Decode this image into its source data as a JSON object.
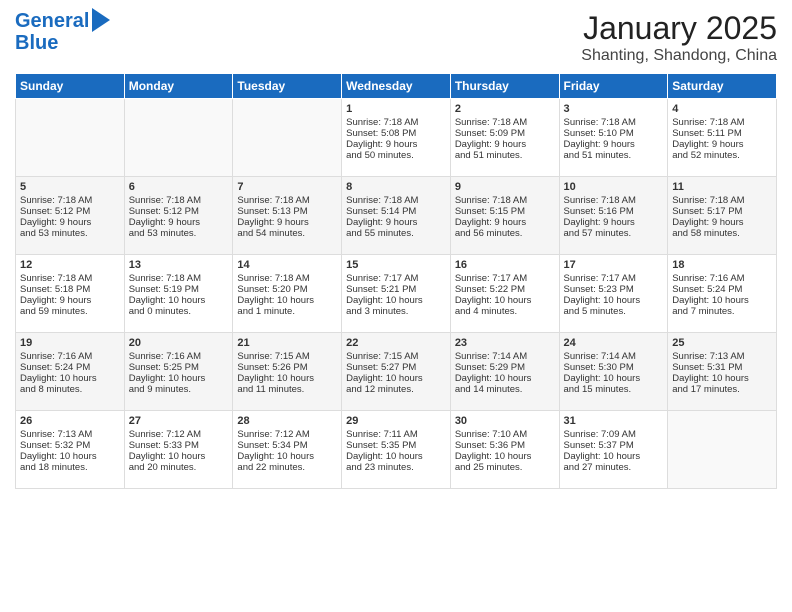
{
  "logo": {
    "line1": "General",
    "line2": "Blue"
  },
  "title": "January 2025",
  "subtitle": "Shanting, Shandong, China",
  "days_header": [
    "Sunday",
    "Monday",
    "Tuesday",
    "Wednesday",
    "Thursday",
    "Friday",
    "Saturday"
  ],
  "weeks": [
    [
      {
        "day": "",
        "info": ""
      },
      {
        "day": "",
        "info": ""
      },
      {
        "day": "",
        "info": ""
      },
      {
        "day": "1",
        "info": "Sunrise: 7:18 AM\nSunset: 5:08 PM\nDaylight: 9 hours\nand 50 minutes."
      },
      {
        "day": "2",
        "info": "Sunrise: 7:18 AM\nSunset: 5:09 PM\nDaylight: 9 hours\nand 51 minutes."
      },
      {
        "day": "3",
        "info": "Sunrise: 7:18 AM\nSunset: 5:10 PM\nDaylight: 9 hours\nand 51 minutes."
      },
      {
        "day": "4",
        "info": "Sunrise: 7:18 AM\nSunset: 5:11 PM\nDaylight: 9 hours\nand 52 minutes."
      }
    ],
    [
      {
        "day": "5",
        "info": "Sunrise: 7:18 AM\nSunset: 5:12 PM\nDaylight: 9 hours\nand 53 minutes."
      },
      {
        "day": "6",
        "info": "Sunrise: 7:18 AM\nSunset: 5:12 PM\nDaylight: 9 hours\nand 53 minutes."
      },
      {
        "day": "7",
        "info": "Sunrise: 7:18 AM\nSunset: 5:13 PM\nDaylight: 9 hours\nand 54 minutes."
      },
      {
        "day": "8",
        "info": "Sunrise: 7:18 AM\nSunset: 5:14 PM\nDaylight: 9 hours\nand 55 minutes."
      },
      {
        "day": "9",
        "info": "Sunrise: 7:18 AM\nSunset: 5:15 PM\nDaylight: 9 hours\nand 56 minutes."
      },
      {
        "day": "10",
        "info": "Sunrise: 7:18 AM\nSunset: 5:16 PM\nDaylight: 9 hours\nand 57 minutes."
      },
      {
        "day": "11",
        "info": "Sunrise: 7:18 AM\nSunset: 5:17 PM\nDaylight: 9 hours\nand 58 minutes."
      }
    ],
    [
      {
        "day": "12",
        "info": "Sunrise: 7:18 AM\nSunset: 5:18 PM\nDaylight: 9 hours\nand 59 minutes."
      },
      {
        "day": "13",
        "info": "Sunrise: 7:18 AM\nSunset: 5:19 PM\nDaylight: 10 hours\nand 0 minutes."
      },
      {
        "day": "14",
        "info": "Sunrise: 7:18 AM\nSunset: 5:20 PM\nDaylight: 10 hours\nand 1 minute."
      },
      {
        "day": "15",
        "info": "Sunrise: 7:17 AM\nSunset: 5:21 PM\nDaylight: 10 hours\nand 3 minutes."
      },
      {
        "day": "16",
        "info": "Sunrise: 7:17 AM\nSunset: 5:22 PM\nDaylight: 10 hours\nand 4 minutes."
      },
      {
        "day": "17",
        "info": "Sunrise: 7:17 AM\nSunset: 5:23 PM\nDaylight: 10 hours\nand 5 minutes."
      },
      {
        "day": "18",
        "info": "Sunrise: 7:16 AM\nSunset: 5:24 PM\nDaylight: 10 hours\nand 7 minutes."
      }
    ],
    [
      {
        "day": "19",
        "info": "Sunrise: 7:16 AM\nSunset: 5:24 PM\nDaylight: 10 hours\nand 8 minutes."
      },
      {
        "day": "20",
        "info": "Sunrise: 7:16 AM\nSunset: 5:25 PM\nDaylight: 10 hours\nand 9 minutes."
      },
      {
        "day": "21",
        "info": "Sunrise: 7:15 AM\nSunset: 5:26 PM\nDaylight: 10 hours\nand 11 minutes."
      },
      {
        "day": "22",
        "info": "Sunrise: 7:15 AM\nSunset: 5:27 PM\nDaylight: 10 hours\nand 12 minutes."
      },
      {
        "day": "23",
        "info": "Sunrise: 7:14 AM\nSunset: 5:29 PM\nDaylight: 10 hours\nand 14 minutes."
      },
      {
        "day": "24",
        "info": "Sunrise: 7:14 AM\nSunset: 5:30 PM\nDaylight: 10 hours\nand 15 minutes."
      },
      {
        "day": "25",
        "info": "Sunrise: 7:13 AM\nSunset: 5:31 PM\nDaylight: 10 hours\nand 17 minutes."
      }
    ],
    [
      {
        "day": "26",
        "info": "Sunrise: 7:13 AM\nSunset: 5:32 PM\nDaylight: 10 hours\nand 18 minutes."
      },
      {
        "day": "27",
        "info": "Sunrise: 7:12 AM\nSunset: 5:33 PM\nDaylight: 10 hours\nand 20 minutes."
      },
      {
        "day": "28",
        "info": "Sunrise: 7:12 AM\nSunset: 5:34 PM\nDaylight: 10 hours\nand 22 minutes."
      },
      {
        "day": "29",
        "info": "Sunrise: 7:11 AM\nSunset: 5:35 PM\nDaylight: 10 hours\nand 23 minutes."
      },
      {
        "day": "30",
        "info": "Sunrise: 7:10 AM\nSunset: 5:36 PM\nDaylight: 10 hours\nand 25 minutes."
      },
      {
        "day": "31",
        "info": "Sunrise: 7:09 AM\nSunset: 5:37 PM\nDaylight: 10 hours\nand 27 minutes."
      },
      {
        "day": "",
        "info": ""
      }
    ]
  ]
}
